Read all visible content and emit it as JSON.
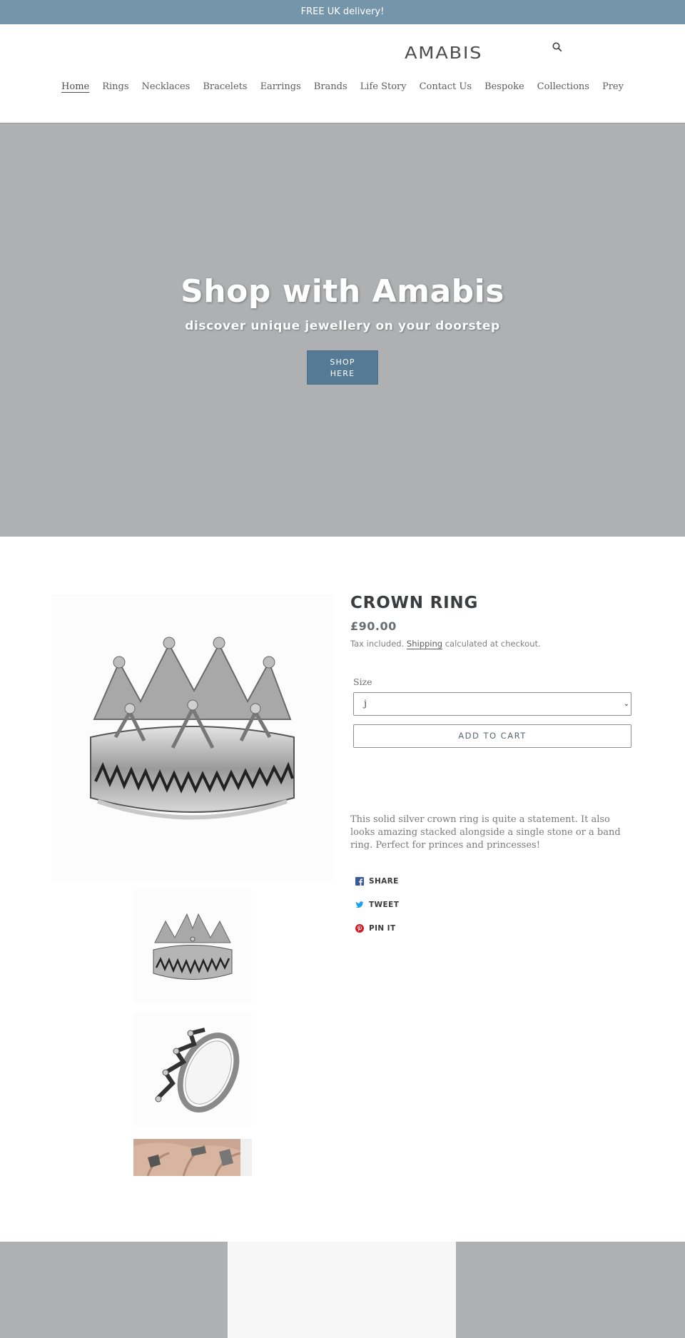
{
  "announcement": {
    "text": "FREE UK delivery!"
  },
  "header": {
    "logo": "AMABIS",
    "search_icon": "search-icon",
    "nav": [
      {
        "label": "Home",
        "active": true
      },
      {
        "label": "Rings"
      },
      {
        "label": "Necklaces"
      },
      {
        "label": "Bracelets"
      },
      {
        "label": "Earrings"
      },
      {
        "label": "Brands"
      },
      {
        "label": "Life Story"
      },
      {
        "label": "Contact Us"
      },
      {
        "label": "Bespoke"
      },
      {
        "label": "Collections"
      },
      {
        "label": "Prey"
      }
    ]
  },
  "hero": {
    "title": "Shop with Amabis",
    "subtitle": "discover unique jewellery on your doorstep",
    "button_line1": "SHOP",
    "button_line2": "HERE",
    "background_color": "#afb0b2",
    "button_color": "#557a95"
  },
  "product": {
    "title": "CROWN RING",
    "price": "£90.00",
    "tax_prefix": "Tax included.",
    "shipping_link": "Shipping",
    "tax_suffix": "calculated at checkout.",
    "size_label": "Size",
    "size_value": "j",
    "add_to_cart": "ADD TO CART",
    "description": "This solid silver crown ring is quite a statement. It also looks amazing stacked alongside a single stone or a band ring. Perfect for princes and princesses!",
    "images": [
      {
        "alt": "Crown ring front view",
        "kind": "main"
      },
      {
        "alt": "Crown ring front view thumbnail",
        "kind": "thumb"
      },
      {
        "alt": "Crown ring angled view thumbnail",
        "kind": "thumb"
      },
      {
        "alt": "Crown rings worn on hand thumbnail",
        "kind": "thumb"
      }
    ]
  },
  "share": {
    "facebook": {
      "label": "SHARE",
      "icon": "facebook-icon",
      "color": "#3b5998"
    },
    "twitter": {
      "label": "TWEET",
      "icon": "twitter-icon",
      "color": "#1da1f2"
    },
    "pinterest": {
      "label": "PIN IT",
      "icon": "pinterest-icon",
      "color": "#cb2027"
    }
  },
  "colors": {
    "announcement_bg": "#7596aa",
    "footer_gray": "#afb0b2",
    "footer_light": "#f6f6f6"
  }
}
